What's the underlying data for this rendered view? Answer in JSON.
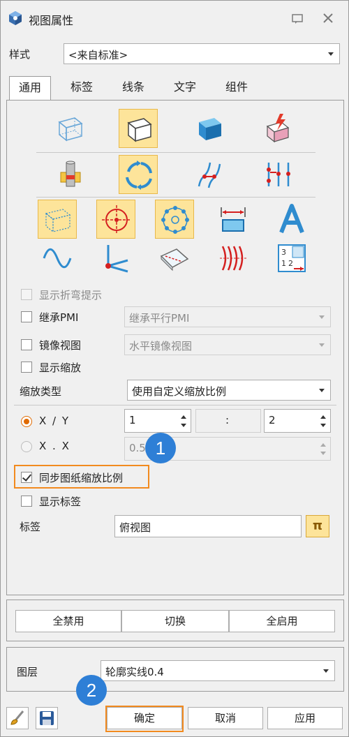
{
  "window": {
    "title": "视图属性"
  },
  "style_row": {
    "label": "样式",
    "value": "<来自标准>"
  },
  "tabs": [
    {
      "label": "通用",
      "active": true
    },
    {
      "label": "标签",
      "active": false
    },
    {
      "label": "线条",
      "active": false
    },
    {
      "label": "文字",
      "active": false
    },
    {
      "label": "组件",
      "active": false
    }
  ],
  "options": {
    "show_bend_hint": "显示折弯提示",
    "inherit_pmi": "继承PMI",
    "inherit_pmi_value": "继承平行PMI",
    "mirror_view": "镜像视图",
    "mirror_view_value": "水平镜像视图",
    "show_scale": "显示缩放",
    "scale_type_label": "缩放类型",
    "scale_type_value": "使用自定义缩放比例",
    "ratio_xy_label": "X / Y",
    "ratio_x_value": "1",
    "ratio_colon": ":",
    "ratio_y_value": "2",
    "decimal_label": "X . X",
    "decimal_value": "0.5",
    "sync_scale": "同步图纸缩放比例",
    "show_label": "显示标签",
    "label_label": "标签",
    "label_value": "俯视图"
  },
  "toggle_buttons": {
    "disable_all": "全禁用",
    "switch": "切换",
    "enable_all": "全启用"
  },
  "layer": {
    "label": "图层",
    "value": "轮廓实线0.4"
  },
  "footer": {
    "ok": "确定",
    "cancel": "取消",
    "apply": "应用"
  },
  "callouts": {
    "one": "1",
    "two": "2"
  },
  "pi_symbol": "π",
  "colors": {
    "highlight_orange": "#f28a1e",
    "callout_blue": "#2e7fd6",
    "selected_fill": "#fde49a"
  }
}
